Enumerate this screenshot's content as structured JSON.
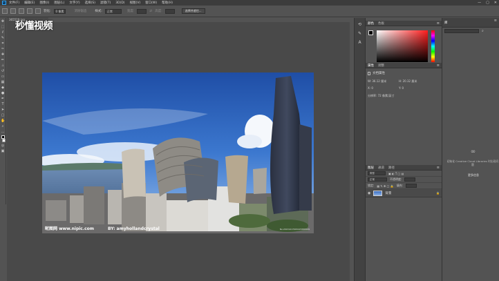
{
  "app": {
    "logo": "Ps"
  },
  "menu": [
    "文件(F)",
    "编辑(E)",
    "图像(I)",
    "图层(L)",
    "文字(Y)",
    "选择(S)",
    "滤镜(T)",
    "3D(D)",
    "视图(V)",
    "窗口(W)",
    "帮助(H)"
  ],
  "window_controls": [
    "—",
    "▢",
    "✕"
  ],
  "options": {
    "feather_label": "羽化:",
    "feather_value": "0 像素",
    "antialias_label": "消除锯齿",
    "style_label": "样式:",
    "style_value": "正常",
    "width_label": "宽度:",
    "height_label": "高度:",
    "select_mask_button": "选择并遮住..."
  },
  "document": {
    "tab_label": "365529.jpg"
  },
  "video_logo": "秒懂视频",
  "watermark": {
    "left": "昵图网 www.nipic.com",
    "right": "BY: amyhollandcrystal",
    "id": "No.20131217093223365529"
  },
  "color_panel": {
    "tabs": [
      "颜色",
      "色板"
    ]
  },
  "properties_panel": {
    "tabs": [
      "属性",
      "调整"
    ],
    "title": "文档属性",
    "w_label": "W:",
    "w_value": "36.12 厘米",
    "h_label": "H:",
    "h_value": "20.32 厘米",
    "x_label": "X:",
    "x_value": "0",
    "y_label": "Y:",
    "y_value": "0",
    "resolution": "分辨率: 72 像素/英寸"
  },
  "layers_panel": {
    "tabs": [
      "图层",
      "通道",
      "路径"
    ],
    "kind_label": "类型",
    "blend_mode": "正常",
    "opacity_label": "不透明度:",
    "lock_label": "锁定:",
    "fill_label": "填充:",
    "layer_name": "背景"
  },
  "libraries_panel": {
    "tab": "库",
    "message": "初始化 Creative Cloud Libraries 时出现问题",
    "link": "更多信息"
  },
  "colors": {
    "fg": "#000000",
    "bg": "#ffffff",
    "accent": "#31a8ff"
  }
}
